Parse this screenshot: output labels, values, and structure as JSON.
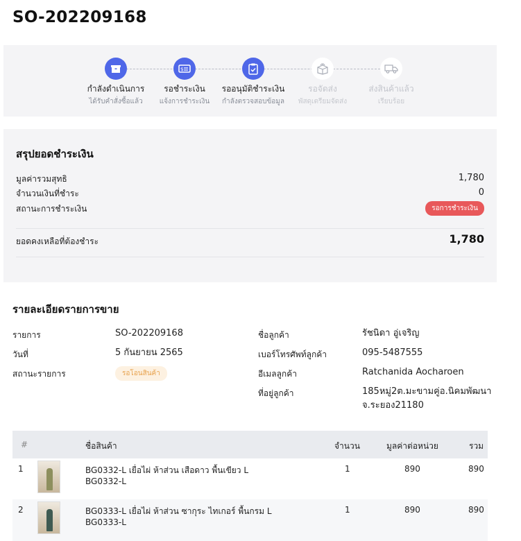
{
  "order": {
    "number": "SO-202209168"
  },
  "steps": [
    {
      "title": "กำลังดำเนินการ",
      "subtitle": "ได้รับคำสั่งซื้อแล้ว",
      "icon": "box-icon",
      "state": "active"
    },
    {
      "title": "รอชำระเงิน",
      "subtitle": "แจ้งการชำระเงิน",
      "icon": "payment-card-icon",
      "state": "active"
    },
    {
      "title": "รออนุมัติชำระเงิน",
      "subtitle": "กำลังตรวจสอบข้อมูล",
      "icon": "clipboard-check-icon",
      "state": "active"
    },
    {
      "title": "รอจัดส่ง",
      "subtitle": "พัสดุเตรียมจัดส่ง",
      "icon": "package-icon",
      "state": "inactive"
    },
    {
      "title": "ส่งสินค้าแล้ว",
      "subtitle": "เรียบร้อย",
      "icon": "truck-icon",
      "state": "inactive"
    }
  ],
  "payment": {
    "title": "สรุปยอดชำระเงิน",
    "net_label": "มูลค่ารวมสุทธิ",
    "net_value": "1,780",
    "paid_label": "จำนวนเงินที่ชำระ",
    "paid_value": "0",
    "status_label": "สถานะการชำระเงิน",
    "status_value": "รอการชำระเงิน",
    "balance_label": "ยอดคงเหลือที่ต้องชำระ",
    "balance_value": "1,780",
    "status_color": "#e8585a"
  },
  "detail": {
    "title": "รายละเอียดรายการขาย",
    "item_label": "รายการ",
    "item_value": "SO-202209168",
    "date_label": "วันที่",
    "date_value": "5 กันยายน 2565",
    "status_label": "สถานะรายการ",
    "status_value": "รอโอนสินค้า",
    "customer_label": "ชื่อลูกค้า",
    "customer_value": "รัชนิดา อู่เจริญ",
    "phone_label": "เบอร์โทรศัพท์ลูกค้า",
    "phone_value": "095-5487555",
    "email_label": "อีเมลลูกค้า",
    "email_value": "Ratchanida Aocharoen",
    "address_label": "ที่อยู่ลูกค้า",
    "address_line1": "185หมู่2ต.มะขามคู่อ.นิคมพัฒนา",
    "address_line2": "จ.ระยอง21180"
  },
  "table": {
    "headers": {
      "index": "#",
      "name": "ชื่อสินค้า",
      "qty": "จำนวน",
      "unit_price": "มูลค่าต่อหน่วย",
      "total": "รวม"
    },
    "rows": [
      {
        "index": "1",
        "name": "BG0332-L เยื่อไผ่ ห้าส่วน เสือดาว พื้นเขียว L",
        "sku": "BG0332-L",
        "qty": "1",
        "unit_price": "890",
        "total": "890"
      },
      {
        "index": "2",
        "name": "BG0333-L เยื่อไผ่ ห้าส่วน ซากุระ ไทเกอร์ พื้นกรม L",
        "sku": "BG0333-L",
        "qty": "1",
        "unit_price": "890",
        "total": "890"
      }
    ]
  },
  "colors": {
    "accent": "#4f67e8",
    "panel_bg": "#f4f4f6",
    "pending_badge_bg": "#fdf1e1",
    "pending_badge_text": "#e7a14c"
  }
}
